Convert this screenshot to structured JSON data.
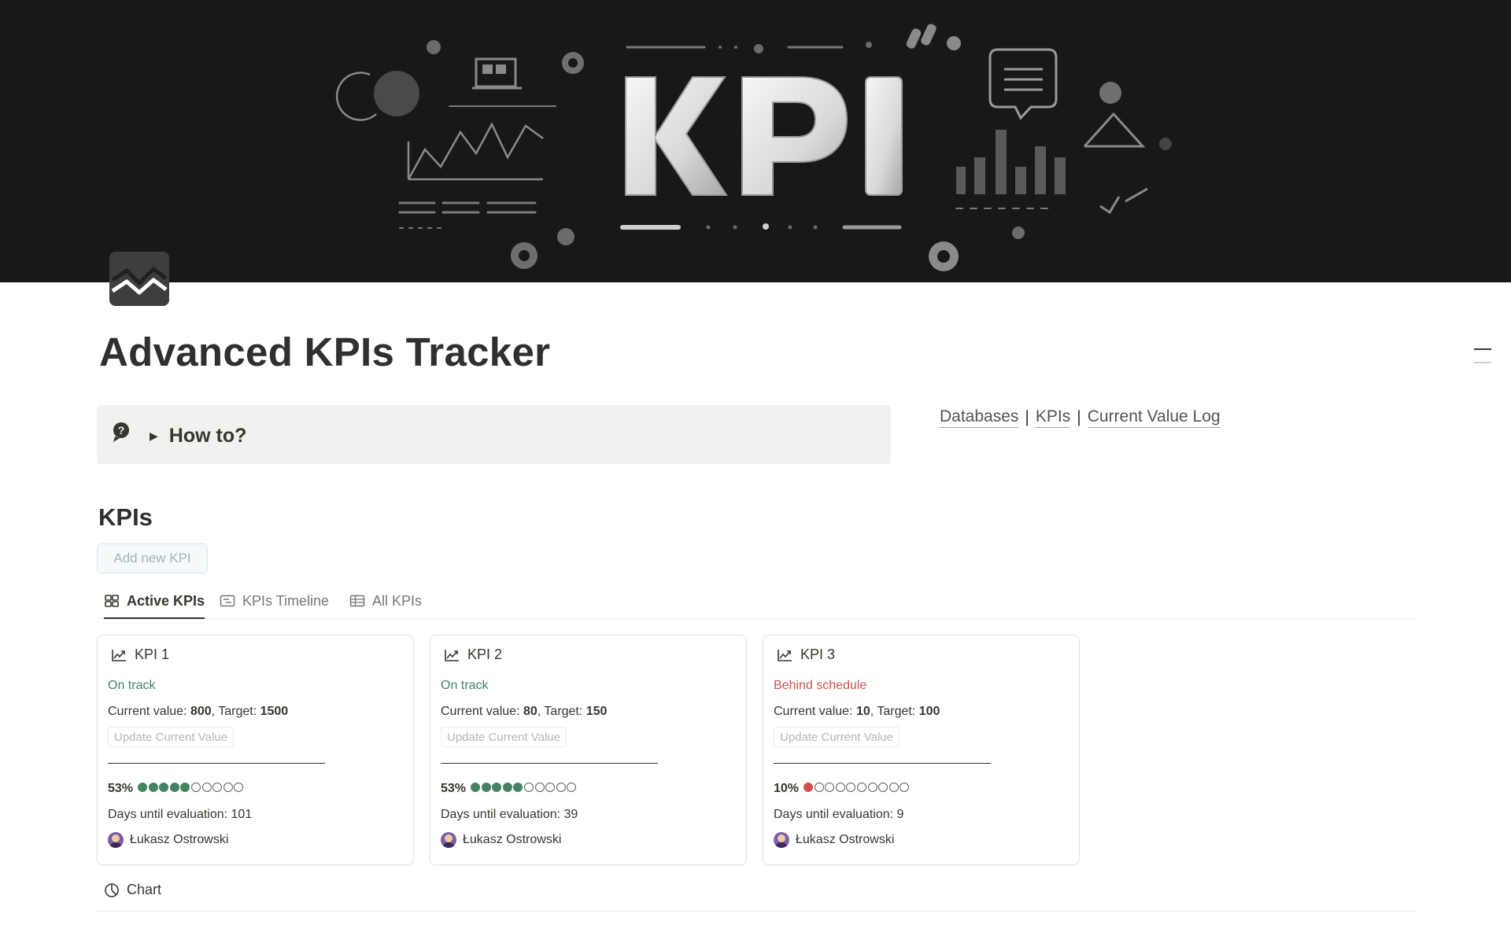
{
  "cover": {
    "banner_text": "KPI"
  },
  "page": {
    "title": "Advanced KPIs Tracker",
    "icon": "trend-chart-icon"
  },
  "callout": {
    "icon": "question-bubble-icon",
    "toggle_label": "How to?"
  },
  "links": {
    "databases": "Databases",
    "kpis": "KPIs",
    "log": "Current Value Log",
    "separator": "|"
  },
  "section": {
    "heading": "KPIs",
    "add_button": "Add new KPI"
  },
  "tabs": [
    {
      "label": "Active KPIs",
      "icon": "gallery-icon",
      "active": true
    },
    {
      "label": "KPIs Timeline",
      "icon": "timeline-icon",
      "active": false
    },
    {
      "label": "All KPIs",
      "icon": "table-icon",
      "active": false
    }
  ],
  "labels": {
    "current_value": "Current value: ",
    "target": ", Target: ",
    "update_button": "Update Current Value",
    "days_prefix": "Days until evaluation: "
  },
  "cards": [
    {
      "title": "KPI 1",
      "status": "On track",
      "status_type": "good",
      "current": "800",
      "target": "1500",
      "percent": "53%",
      "filled": 5,
      "total": 10,
      "dot_color": "#448361",
      "days": "101",
      "owner": "Łukasz Ostrowski"
    },
    {
      "title": "KPI 2",
      "status": "On track",
      "status_type": "good",
      "current": "80",
      "target": "150",
      "percent": "53%",
      "filled": 5,
      "total": 10,
      "dot_color": "#448361",
      "days": "39",
      "owner": "Łukasz Ostrowski"
    },
    {
      "title": "KPI 3",
      "status": "Behind schedule",
      "status_type": "bad",
      "current": "10",
      "target": "100",
      "percent": "10%",
      "filled": 1,
      "total": 10,
      "dot_color": "#d44c47",
      "days": "9",
      "owner": "Łukasz Ostrowski"
    }
  ],
  "chart_toggle": {
    "label": "Chart",
    "icon": "chart-icon"
  }
}
